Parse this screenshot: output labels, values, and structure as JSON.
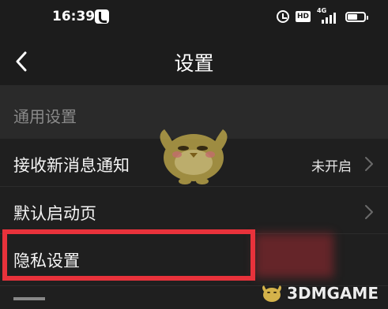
{
  "status_bar": {
    "time": "16:39",
    "hd_label": "HD",
    "network_label": "4G"
  },
  "nav": {
    "title": "设置"
  },
  "section": {
    "title": "通用设置"
  },
  "rows": [
    {
      "label": "接收新消息通知",
      "value": "未开启"
    },
    {
      "label": "默认启动页",
      "value": ""
    },
    {
      "label": "隐私设置",
      "value": ""
    }
  ],
  "watermark": {
    "brand": "3DMGAME"
  },
  "colors": {
    "background": "#1f1f1f",
    "section_bg": "#2a2a2a",
    "highlight": "#e8323b",
    "mascot": "#b5a048"
  },
  "icons": {
    "back": "chevron-left-icon",
    "row_arrow": "chevron-right-icon",
    "alarm": "alarm-icon",
    "battery": "battery-icon",
    "tiktok": "tiktok-icon"
  }
}
